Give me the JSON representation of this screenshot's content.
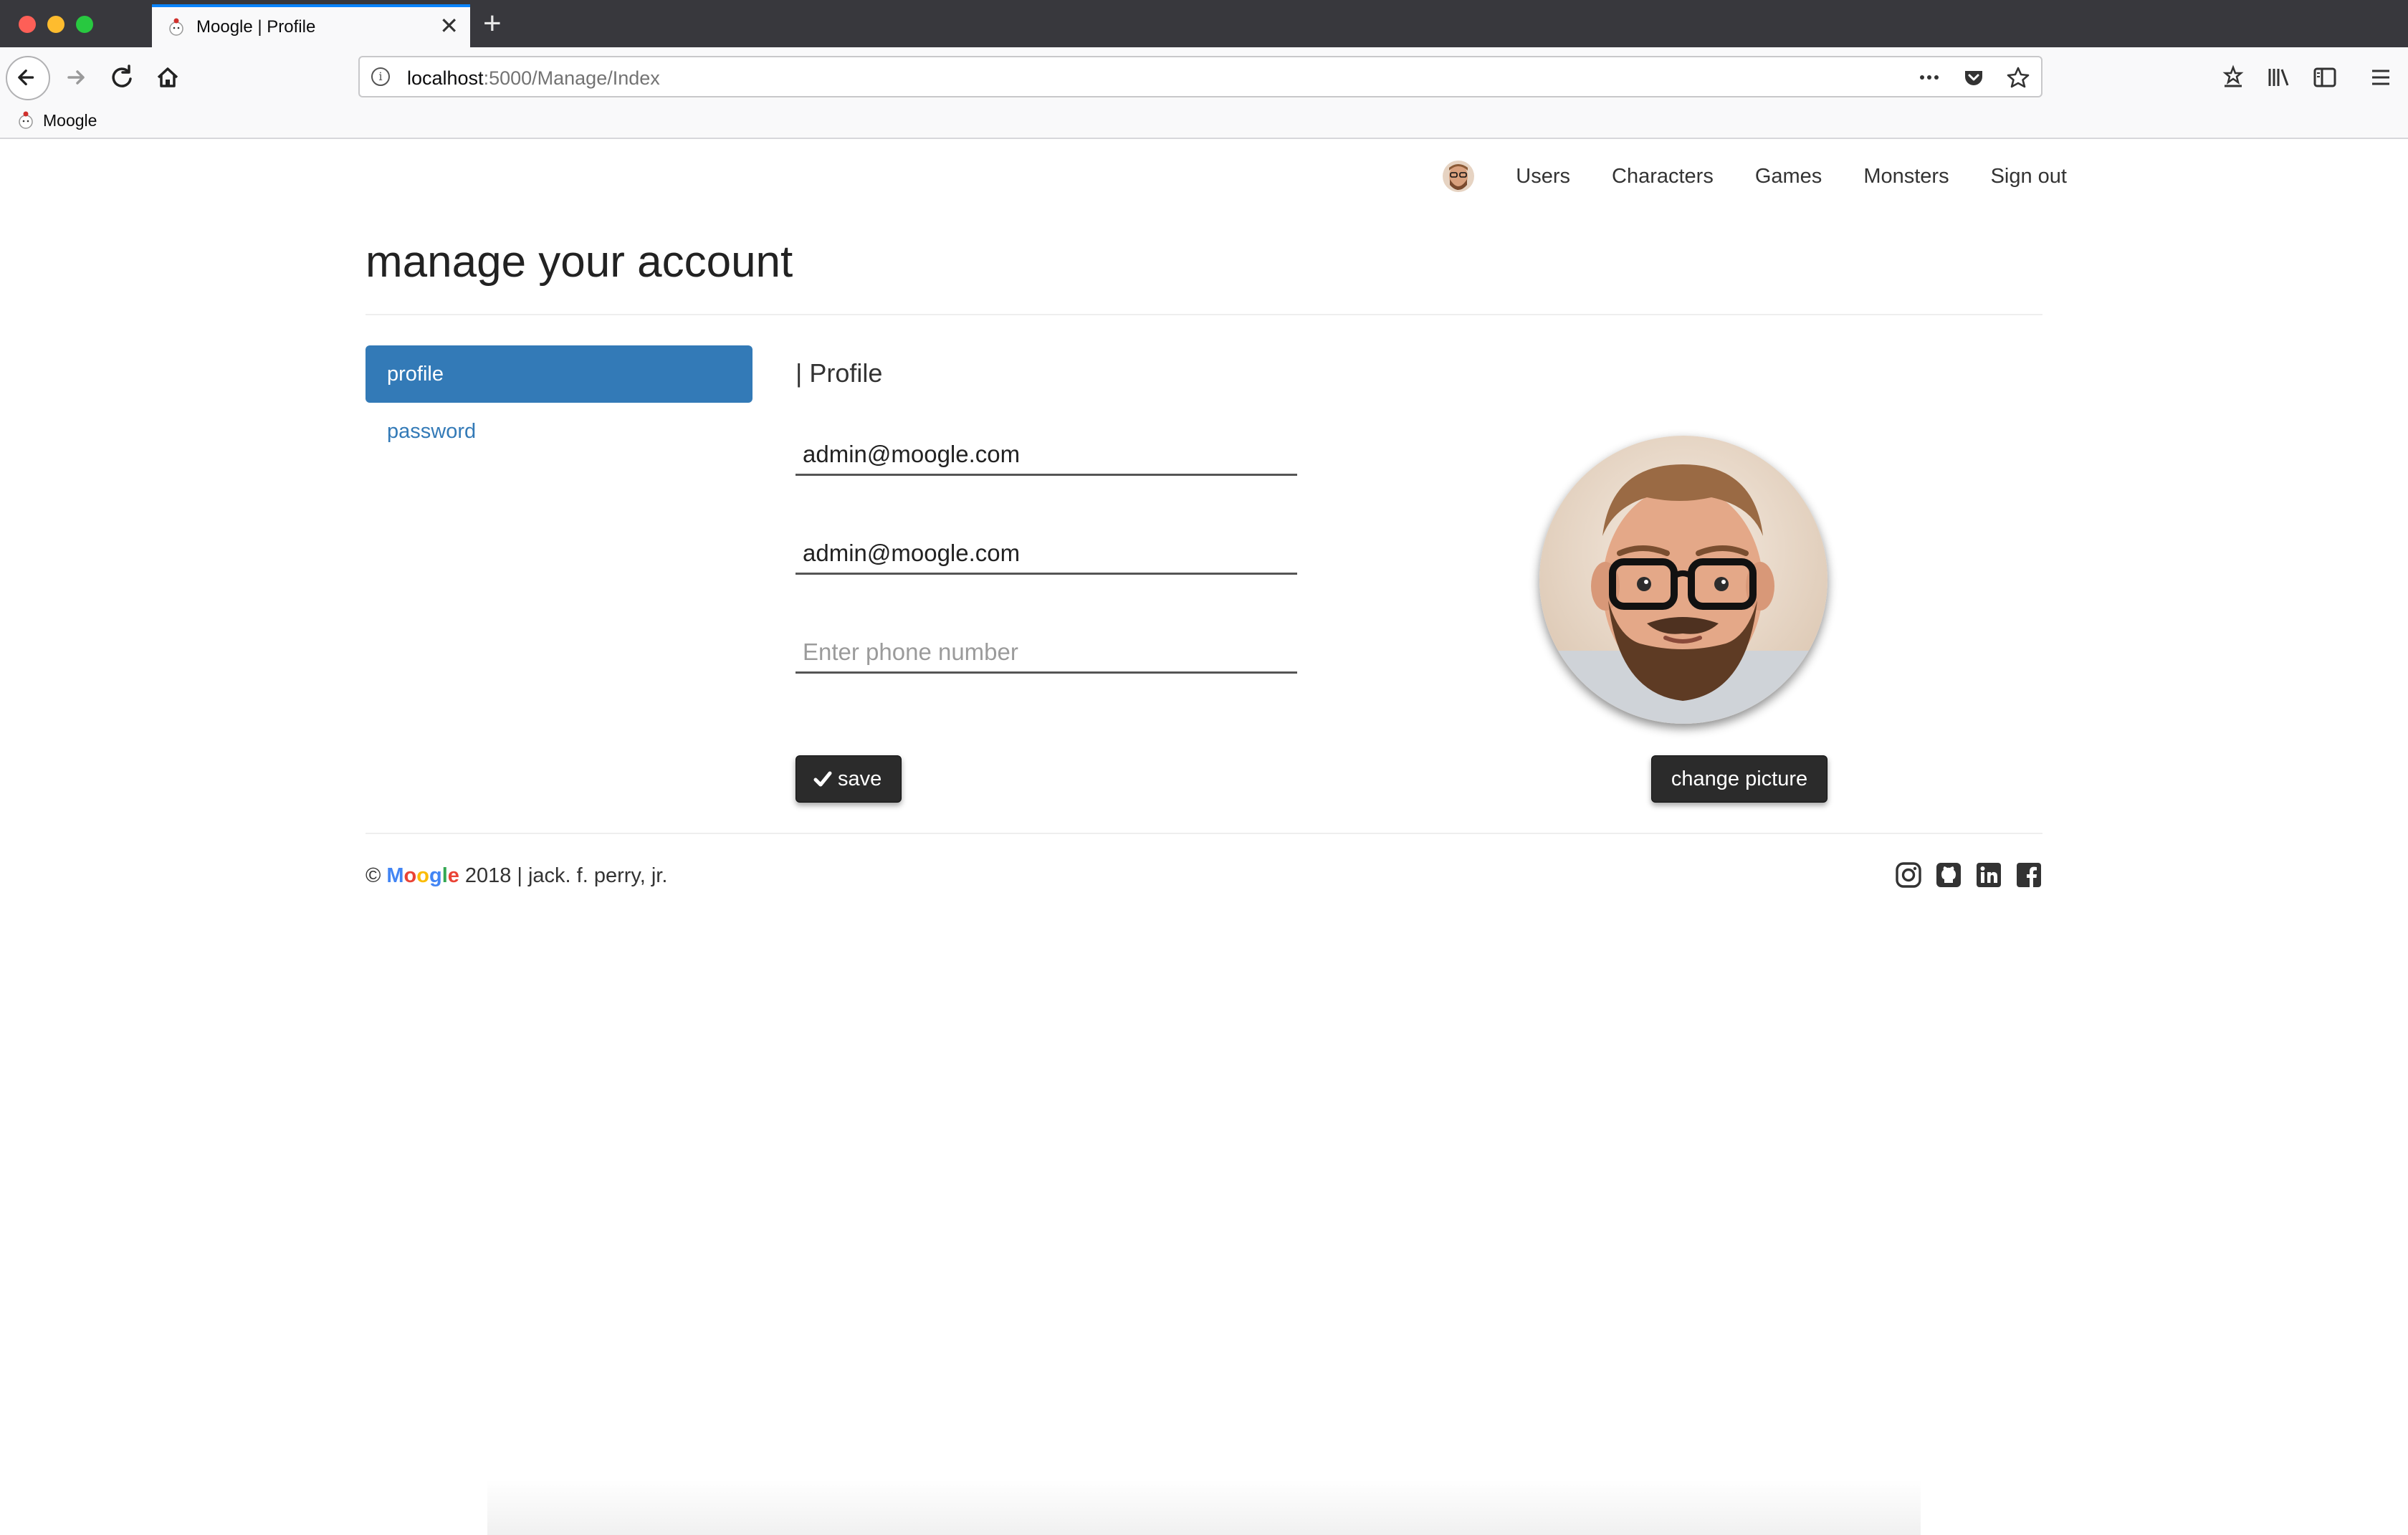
{
  "browser": {
    "tab_title": "Moogle | Profile",
    "tab_close": "✕",
    "new_tab": "+",
    "url_host": "localhost",
    "url_path": ":5000/Manage/Index",
    "bookmark_label": "Moogle"
  },
  "topnav": {
    "items": [
      "Users",
      "Characters",
      "Games",
      "Monsters",
      "Sign out"
    ]
  },
  "page": {
    "title": "manage your account"
  },
  "sidebar": {
    "items": [
      {
        "label": "profile",
        "active": true
      },
      {
        "label": "password",
        "active": false
      }
    ]
  },
  "profile": {
    "section_title": "| Profile",
    "username_value": "admin@moogle.com",
    "email_value": "admin@moogle.com",
    "phone_value": "",
    "phone_placeholder": "Enter phone number",
    "save_label": "save",
    "change_picture_label": "change picture"
  },
  "footer": {
    "copyright": "©",
    "brand_letters": [
      "M",
      "o",
      "o",
      "g",
      "l",
      "e"
    ],
    "brand_colors": [
      "#4285f4",
      "#ea4335",
      "#fbbc05",
      "#4285f4",
      "#34a853",
      "#ea4335"
    ],
    "year": "2018",
    "separator": "|",
    "author": "jack. f. perry, jr."
  },
  "icons": {
    "social": [
      "instagram-icon",
      "github-icon",
      "linkedin-icon",
      "facebook-icon"
    ]
  }
}
